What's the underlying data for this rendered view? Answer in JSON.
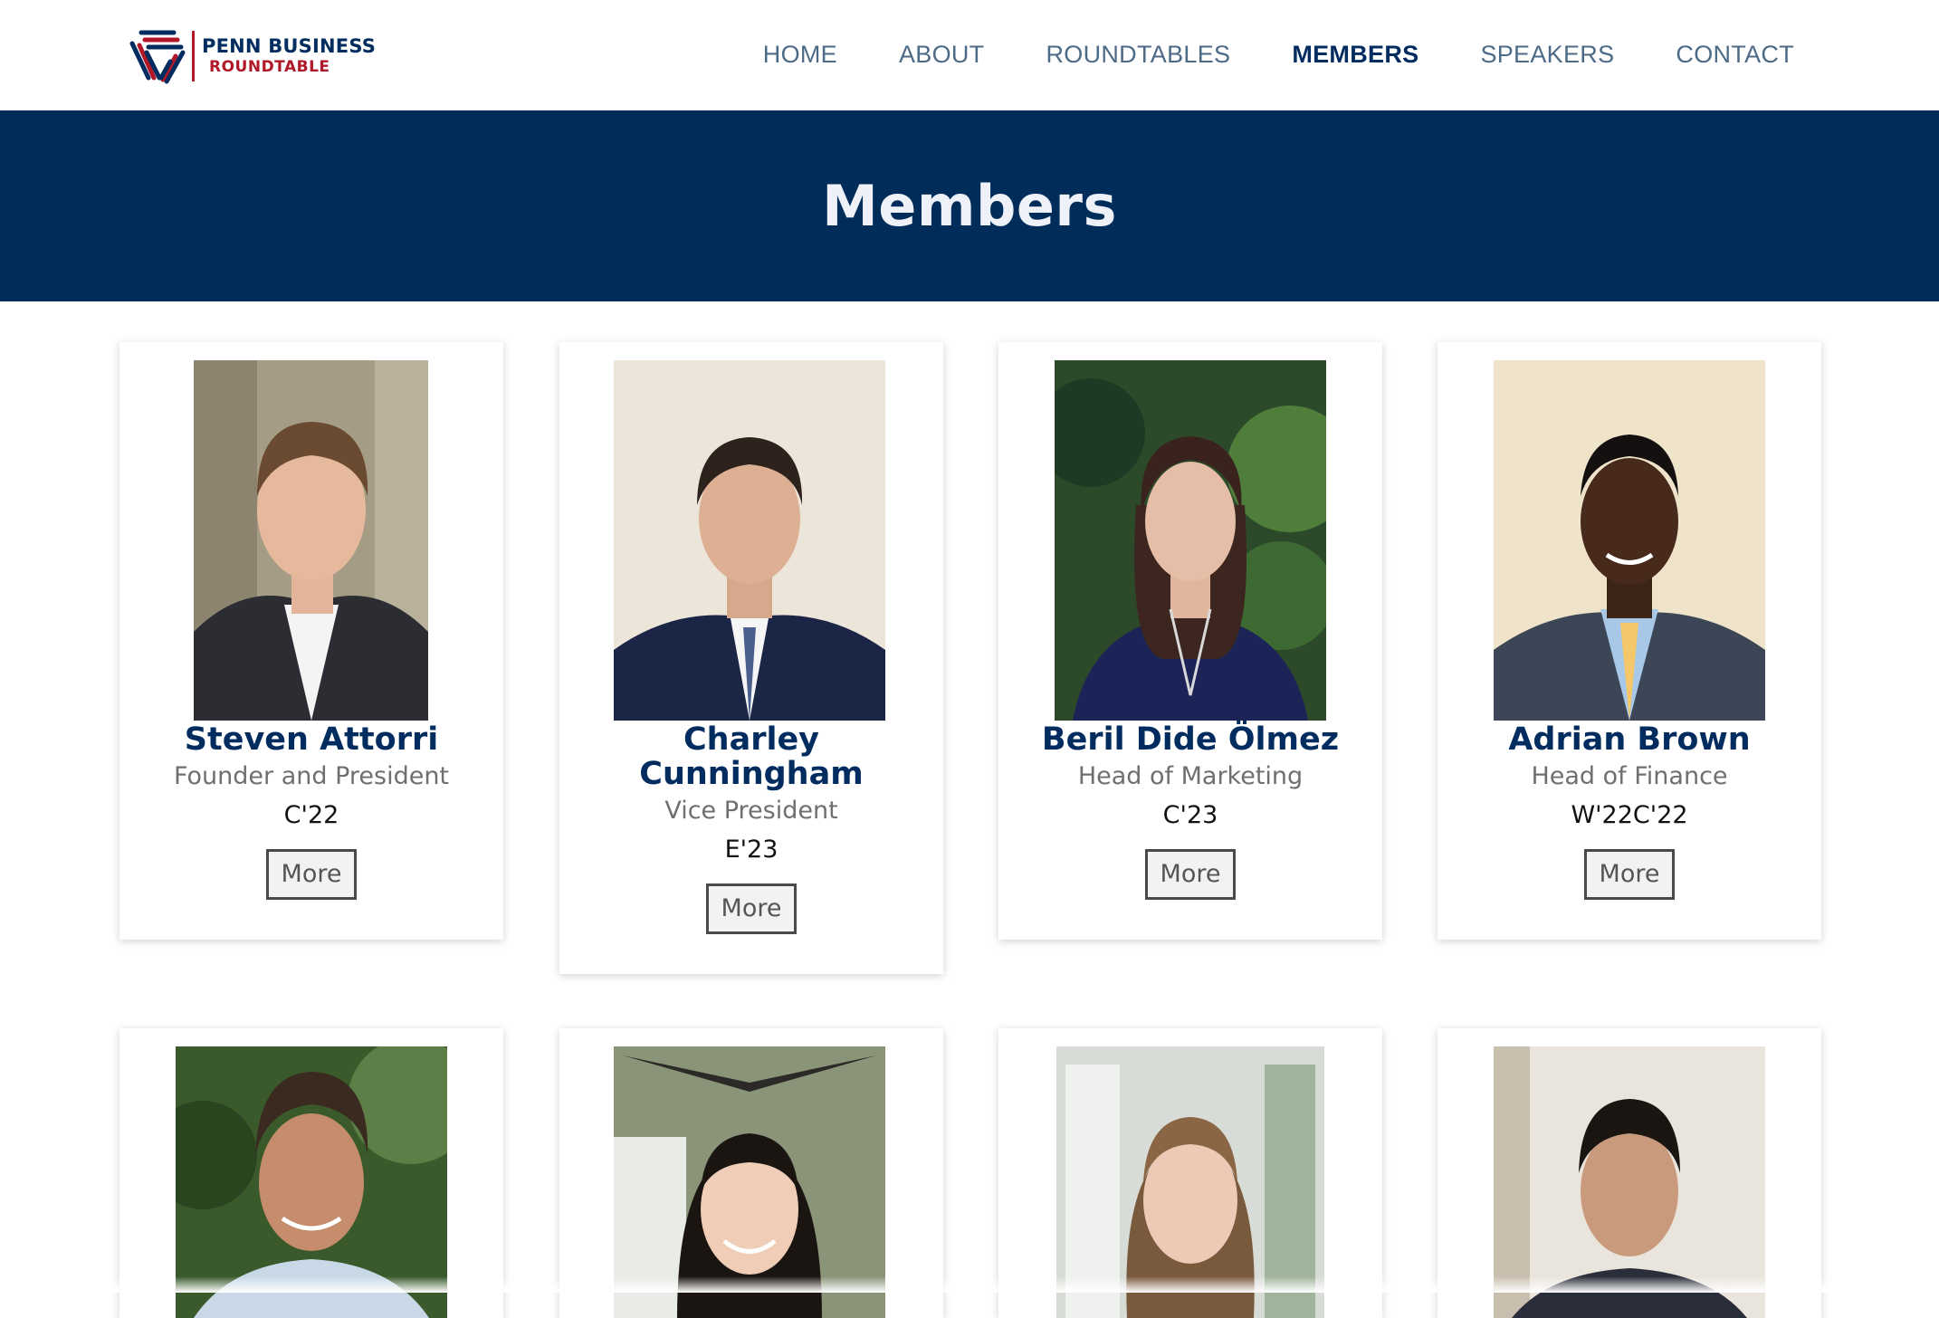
{
  "header": {
    "logo": {
      "line1": "PENN BUSINESS",
      "line2": "ROUNDTABLE",
      "icon": "penn-roundtable-logo-icon"
    },
    "nav": [
      {
        "label": "HOME",
        "active": false
      },
      {
        "label": "ABOUT",
        "active": false
      },
      {
        "label": "ROUNDTABLES",
        "active": false
      },
      {
        "label": "MEMBERS",
        "active": true
      },
      {
        "label": "SPEAKERS",
        "active": false
      },
      {
        "label": "CONTACT",
        "active": false
      }
    ]
  },
  "banner": {
    "title": "Members"
  },
  "members": [
    {
      "name": "Steven Attorri",
      "role": "Founder and President",
      "class": "C'22",
      "more_label": "More"
    },
    {
      "name": "Charley Cunningham",
      "role": "Vice President",
      "class": "E'23",
      "more_label": "More"
    },
    {
      "name": "Beril Dide Ölmez",
      "role": "Head of Marketing",
      "class": "C'23",
      "more_label": "More"
    },
    {
      "name": "Adrian Brown",
      "role": "Head of Finance",
      "class": "W'22C'22",
      "more_label": "More"
    }
  ],
  "colors": {
    "brand_navy": "#002c5f",
    "banner_bg": "#002c5a",
    "brand_red": "#b0182a",
    "nav_text": "#4d6a86",
    "role_text": "#6f6f6f"
  }
}
